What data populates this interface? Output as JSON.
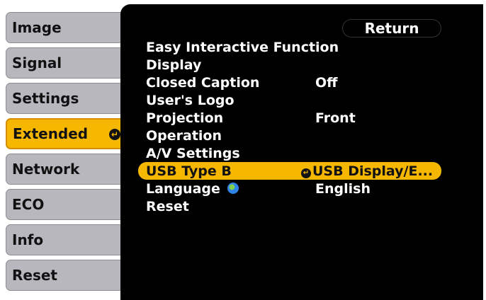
{
  "tabs": [
    {
      "label": "Image"
    },
    {
      "label": "Signal"
    },
    {
      "label": "Settings"
    },
    {
      "label": "Extended"
    },
    {
      "label": "Network"
    },
    {
      "label": "ECO"
    },
    {
      "label": "Info"
    },
    {
      "label": "Reset"
    }
  ],
  "active_tab": "Extended",
  "return_label": "Return",
  "menu": [
    {
      "label": "Easy Interactive Function",
      "value": ""
    },
    {
      "label": "Display",
      "value": ""
    },
    {
      "label": "Closed Caption",
      "value": "Off"
    },
    {
      "label": "User's Logo",
      "value": ""
    },
    {
      "label": "Projection",
      "value": "Front"
    },
    {
      "label": "Operation",
      "value": ""
    },
    {
      "label": "A/V Settings",
      "value": ""
    },
    {
      "label": "USB Type B",
      "value": "USB Display/E..."
    },
    {
      "label": "Language",
      "value": "English"
    },
    {
      "label": "Reset",
      "value": ""
    }
  ],
  "colors": {
    "accent": "#f5b700",
    "panel": "#000000",
    "tab": "#b7b7bd"
  }
}
